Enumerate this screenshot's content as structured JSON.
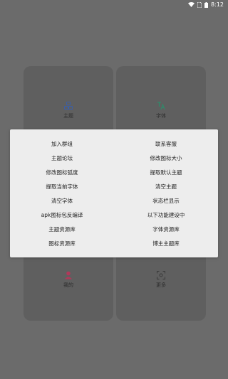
{
  "status_bar": {
    "time": "8:12",
    "icons": [
      "wifi-icon",
      "sim-icon",
      "battery-icon"
    ]
  },
  "background_tiles": [
    {
      "label": "主题",
      "icon": "theme-icon",
      "color": "#3b5fa8"
    },
    {
      "label": "字体",
      "icon": "font-icon",
      "color": "#2f8a6a"
    },
    {
      "label": "我的",
      "icon": "person-icon",
      "color": "#b2385a"
    },
    {
      "label": "更多",
      "icon": "scan-icon",
      "color": "#3a3a3a"
    }
  ],
  "menu": {
    "items": [
      "加入群组",
      "联系客服",
      "主题论坛",
      "修改图标大小",
      "修改图标弧度",
      "提取默认主题",
      "提取当前字体",
      "清空主题",
      "清空字体",
      "状态栏显示",
      "apk图标包反编译",
      "以下功能建设中",
      "主题资源库",
      "字体资源库",
      "图标资源库",
      "博主主题库"
    ]
  }
}
